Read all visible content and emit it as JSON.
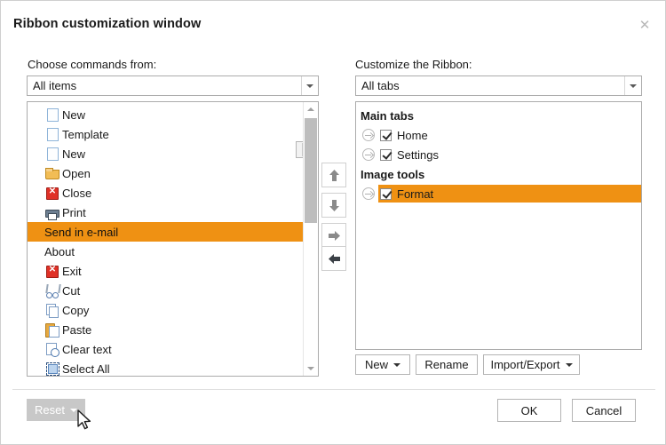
{
  "window": {
    "title": "Ribbon customization window",
    "close_icon": "close-icon",
    "accent_orange": "#ef9113",
    "disabled_gray": "#c8c8c8"
  },
  "left_panel": {
    "label": "Choose commands from:",
    "combo": {
      "value": "All items",
      "arrow_icon": "chevron-down-icon"
    },
    "inline_split_button": {
      "arrow_icon": "chevron-down-icon"
    },
    "items": [
      {
        "label": "New",
        "icon": "blank-page-icon"
      },
      {
        "label": "Template",
        "icon": "blank-page-icon"
      },
      {
        "label": "New",
        "icon": "blank-page-icon"
      },
      {
        "label": "Open",
        "icon": "open-folder-icon"
      },
      {
        "label": "Close",
        "icon": "red-x-icon"
      },
      {
        "label": "Print",
        "icon": "printer-icon"
      },
      {
        "label": "Send in e-mail",
        "icon": "none",
        "selected": true
      },
      {
        "label": "About",
        "icon": "none"
      },
      {
        "label": "Exit",
        "icon": "red-x-icon"
      },
      {
        "label": "Cut",
        "icon": "scissors-icon"
      },
      {
        "label": "Copy",
        "icon": "copy-icon"
      },
      {
        "label": "Paste",
        "icon": "clipboard-paste-icon"
      },
      {
        "label": "Clear text",
        "icon": "clear-text-icon"
      },
      {
        "label": "Select All",
        "icon": "select-all-icon"
      }
    ],
    "scrollbar": {
      "up_icon": "scroll-up-icon",
      "down_icon": "scroll-down-icon"
    }
  },
  "transfer_buttons": [
    {
      "name": "move-up-button",
      "icon": "arrow-up-icon",
      "enabled": false
    },
    {
      "name": "move-down-button",
      "icon": "arrow-down-icon",
      "enabled": false
    },
    {
      "name": "add-button",
      "icon": "arrow-right-icon",
      "enabled": false
    },
    {
      "name": "remove-button",
      "icon": "arrow-left-icon",
      "enabled": true
    }
  ],
  "right_panel": {
    "label": "Customize the Ribbon:",
    "combo": {
      "value": "All tabs",
      "arrow_icon": "chevron-down-icon"
    },
    "tree": [
      {
        "group": "Main tabs",
        "children": [
          {
            "label": "Home",
            "checked": true,
            "selected": false,
            "expander_icon": "expand-arrow-icon"
          },
          {
            "label": "Settings",
            "checked": true,
            "selected": false,
            "expander_icon": "expand-arrow-icon"
          }
        ]
      },
      {
        "group": "Image tools",
        "children": [
          {
            "label": "Format",
            "checked": true,
            "selected": true,
            "expander_icon": "expand-arrow-icon"
          }
        ]
      }
    ],
    "buttons": [
      {
        "label": "New",
        "has_dropdown": true,
        "arrow_icon": "chevron-down-icon"
      },
      {
        "label": "Rename",
        "has_dropdown": false,
        "arrow_icon": ""
      },
      {
        "label": "Import/Export",
        "has_dropdown": true,
        "arrow_icon": "chevron-down-icon"
      }
    ]
  },
  "footer": {
    "reset": {
      "label": "Reset",
      "has_dropdown": true,
      "arrow_icon": "chevron-down-icon",
      "state": "disabled"
    },
    "ok": "OK",
    "cancel": "Cancel",
    "cursor_icon": "mouse-pointer-icon"
  }
}
